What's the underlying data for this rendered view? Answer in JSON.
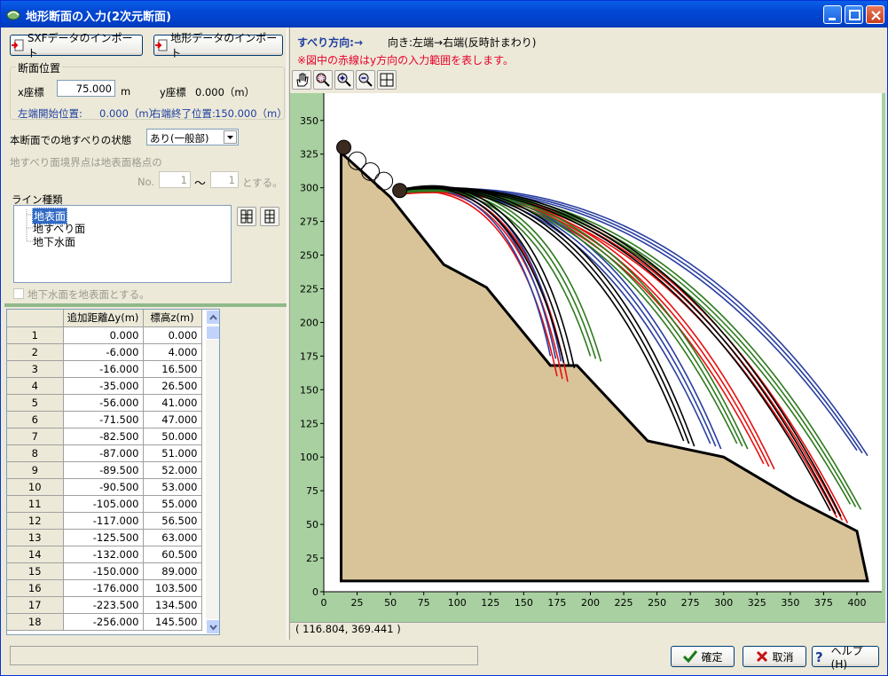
{
  "window": {
    "title": "地形断面の入力(2次元断面)"
  },
  "buttons": {
    "sxf_import": "SXFデータのインポート",
    "terrain_import": "地形データのインポート",
    "ok": "確定",
    "cancel": "取消",
    "help": "ヘルプ(H)"
  },
  "section": {
    "group_label": "断面位置",
    "x_label": "x座標",
    "x_value": "75.000",
    "x_unit": "m",
    "y_label": "y座標",
    "y_value": "0.000（m）",
    "left_start_label": "左端開始位置:",
    "left_start_value": "0.000（m）",
    "right_end_label": "右端終了位置:",
    "right_end_value": "150.000（m）"
  },
  "landslide": {
    "state_label": "本断面での地すべりの状態",
    "state_value": "あり(一般部)"
  },
  "boundary": {
    "label": "地すべり面境界点は地表面格点の",
    "no_label": "No.",
    "from": "1",
    "tilde": "〜",
    "to": "1",
    "suffix": "とする。"
  },
  "line_types": {
    "label": "ライン種類",
    "items": [
      "地表面",
      "地すべり面",
      "地下水面"
    ],
    "selected": 0
  },
  "groundwater_checkbox": "地下水面を地表面とする。",
  "table": {
    "headers": [
      "追加距離Δy(m)",
      "標高z(m)"
    ],
    "rows": [
      [
        "1",
        "0.000",
        "0.000"
      ],
      [
        "2",
        "-6.000",
        "4.000"
      ],
      [
        "3",
        "-16.000",
        "16.500"
      ],
      [
        "4",
        "-35.000",
        "26.500"
      ],
      [
        "5",
        "-56.000",
        "41.000"
      ],
      [
        "6",
        "-71.500",
        "47.000"
      ],
      [
        "7",
        "-82.500",
        "50.000"
      ],
      [
        "8",
        "-87.000",
        "51.000"
      ],
      [
        "9",
        "-89.500",
        "52.000"
      ],
      [
        "10",
        "-90.500",
        "53.000"
      ],
      [
        "11",
        "-105.000",
        "55.000"
      ],
      [
        "12",
        "-117.000",
        "56.500"
      ],
      [
        "13",
        "-125.500",
        "63.000"
      ],
      [
        "14",
        "-132.000",
        "60.500"
      ],
      [
        "15",
        "-150.000",
        "89.000"
      ],
      [
        "16",
        "-176.000",
        "103.500"
      ],
      [
        "17",
        "-223.500",
        "134.500"
      ],
      [
        "18",
        "-256.000",
        "145.500"
      ]
    ]
  },
  "right": {
    "direction_label": "すべり方向:→",
    "orientation": "向き:左端→右端(反時計まわり)",
    "note": "※図中の赤線はy方向の入力範囲を表します。",
    "coord_readout": "( 116.804,  369.441 )"
  },
  "colors": {
    "ground": "#D9C49A",
    "green_axis": "#A8D0A0",
    "red_curve": "#E81010",
    "blue_curve": "#2A3FA0",
    "green_curve": "#2E7A1E"
  },
  "chart_data": {
    "type": "line",
    "xticks": [
      0,
      25,
      50,
      75,
      100,
      125,
      150,
      175,
      200,
      225,
      250,
      275,
      300,
      325,
      350,
      375,
      400
    ],
    "yticks": [
      0,
      25,
      50,
      75,
      100,
      125,
      150,
      175,
      200,
      225,
      250,
      275,
      300,
      325,
      350
    ],
    "xlim": [
      0,
      408
    ],
    "ylim": [
      0,
      365
    ],
    "ground_profile": [
      [
        13,
        326
      ],
      [
        50,
        293
      ],
      [
        90,
        243
      ],
      [
        122,
        226
      ],
      [
        170,
        168
      ],
      [
        190,
        168
      ],
      [
        243,
        112
      ],
      [
        300,
        100
      ],
      [
        353,
        69
      ],
      [
        400,
        45
      ],
      [
        408,
        8
      ],
      [
        13,
        8
      ]
    ],
    "curve_groups": [
      {
        "color": "red",
        "start": [
          55,
          295
        ],
        "ends": [
          [
            175,
            160
          ],
          [
            330,
            95
          ],
          [
            385,
            55
          ]
        ]
      },
      {
        "color": "blue",
        "start": [
          55,
          297
        ],
        "ends": [
          [
            170,
            175
          ],
          [
            290,
            110
          ],
          [
            400,
            105
          ]
        ]
      },
      {
        "color": "green",
        "start": [
          55,
          296
        ],
        "ends": [
          [
            200,
            175
          ],
          [
            310,
            110
          ],
          [
            395,
            65
          ]
        ]
      },
      {
        "color": "black",
        "start": [
          55,
          298
        ],
        "ends": [
          [
            180,
            170
          ],
          [
            270,
            112
          ],
          [
            380,
            60
          ]
        ]
      }
    ]
  }
}
